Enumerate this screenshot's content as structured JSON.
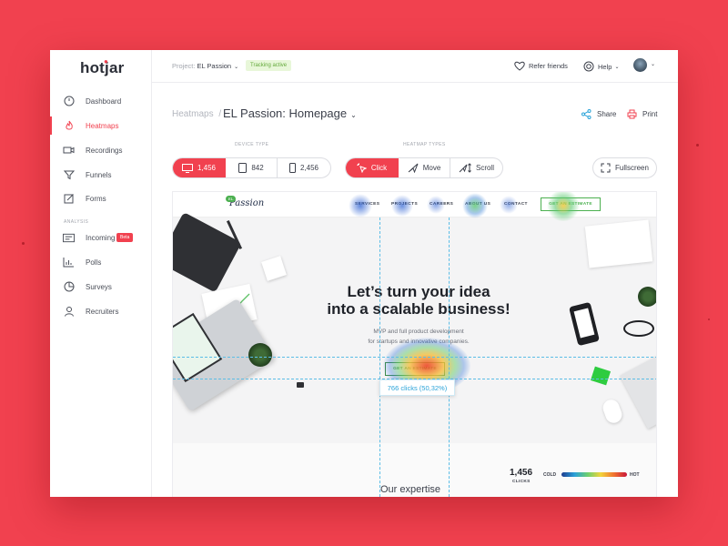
{
  "app": {
    "logo": "hotjar"
  },
  "topbar": {
    "project_label": "Project:",
    "project_name": "EL Passion",
    "tracking_badge": "Tracking active",
    "refer_friends": "Refer friends",
    "help": "Help"
  },
  "sidebar": {
    "items": [
      {
        "label": "Dashboard",
        "icon": "dashboard-icon",
        "active": false
      },
      {
        "label": "Heatmaps",
        "icon": "flame-icon",
        "active": true
      },
      {
        "label": "Recordings",
        "icon": "video-icon",
        "active": false
      },
      {
        "label": "Funnels",
        "icon": "funnel-icon",
        "active": false
      },
      {
        "label": "Forms",
        "icon": "form-icon",
        "active": false
      }
    ],
    "section_label": "ANALYSIS",
    "analysis_items": [
      {
        "label": "Incoming",
        "icon": "incoming-icon",
        "badge": "Beta"
      },
      {
        "label": "Polls",
        "icon": "poll-icon"
      },
      {
        "label": "Surveys",
        "icon": "survey-icon"
      },
      {
        "label": "Recruiters",
        "icon": "recruiter-icon"
      }
    ]
  },
  "header": {
    "breadcrumb_parent": "Heatmaps",
    "breadcrumb_sep": "/",
    "title": "EL Passion: Homepage",
    "share": "Share",
    "print": "Print"
  },
  "controls": {
    "device_type_label": "DEVICE TYPE",
    "devices": [
      {
        "icon": "desktop-icon",
        "count": "1,456",
        "selected": true
      },
      {
        "icon": "tablet-icon",
        "count": "842",
        "selected": false
      },
      {
        "icon": "mobile-icon",
        "count": "2,456",
        "selected": false
      }
    ],
    "heatmap_types_label": "HEATMAP TYPES",
    "types": [
      {
        "icon": "click-icon",
        "label": "Click",
        "selected": true
      },
      {
        "icon": "move-icon",
        "label": "Move",
        "selected": false
      },
      {
        "icon": "scroll-icon",
        "label": "Scroll",
        "selected": false
      }
    ],
    "fullscreen": "Fullscreen"
  },
  "preview": {
    "site_logo": "Passion",
    "site_logo_badge": "EL",
    "nav_links": [
      "SERVICES",
      "PROJECTS",
      "CAREERS",
      "ABOUT US",
      "CONTACT"
    ],
    "nav_cta": "GET AN ESTIMATE",
    "headline_line1": "Let’s turn your idea",
    "headline_line2": "into a scalable business!",
    "sub_line1": "MVP and full product development",
    "sub_line2": "for startups and innovative companies.",
    "hero_cta": "GET AN ESTIMATE",
    "tooltip": "766 clicks (50,32%)",
    "section_title": "Our expertise",
    "total_clicks": "1,456",
    "total_clicks_label": "CLICKS",
    "legend_cold": "COLD",
    "legend_hot": "HOT"
  },
  "colors": {
    "brand": "#f1414f",
    "tracking_green": "#63a83a",
    "highlight_blue": "#2aa3d9"
  }
}
